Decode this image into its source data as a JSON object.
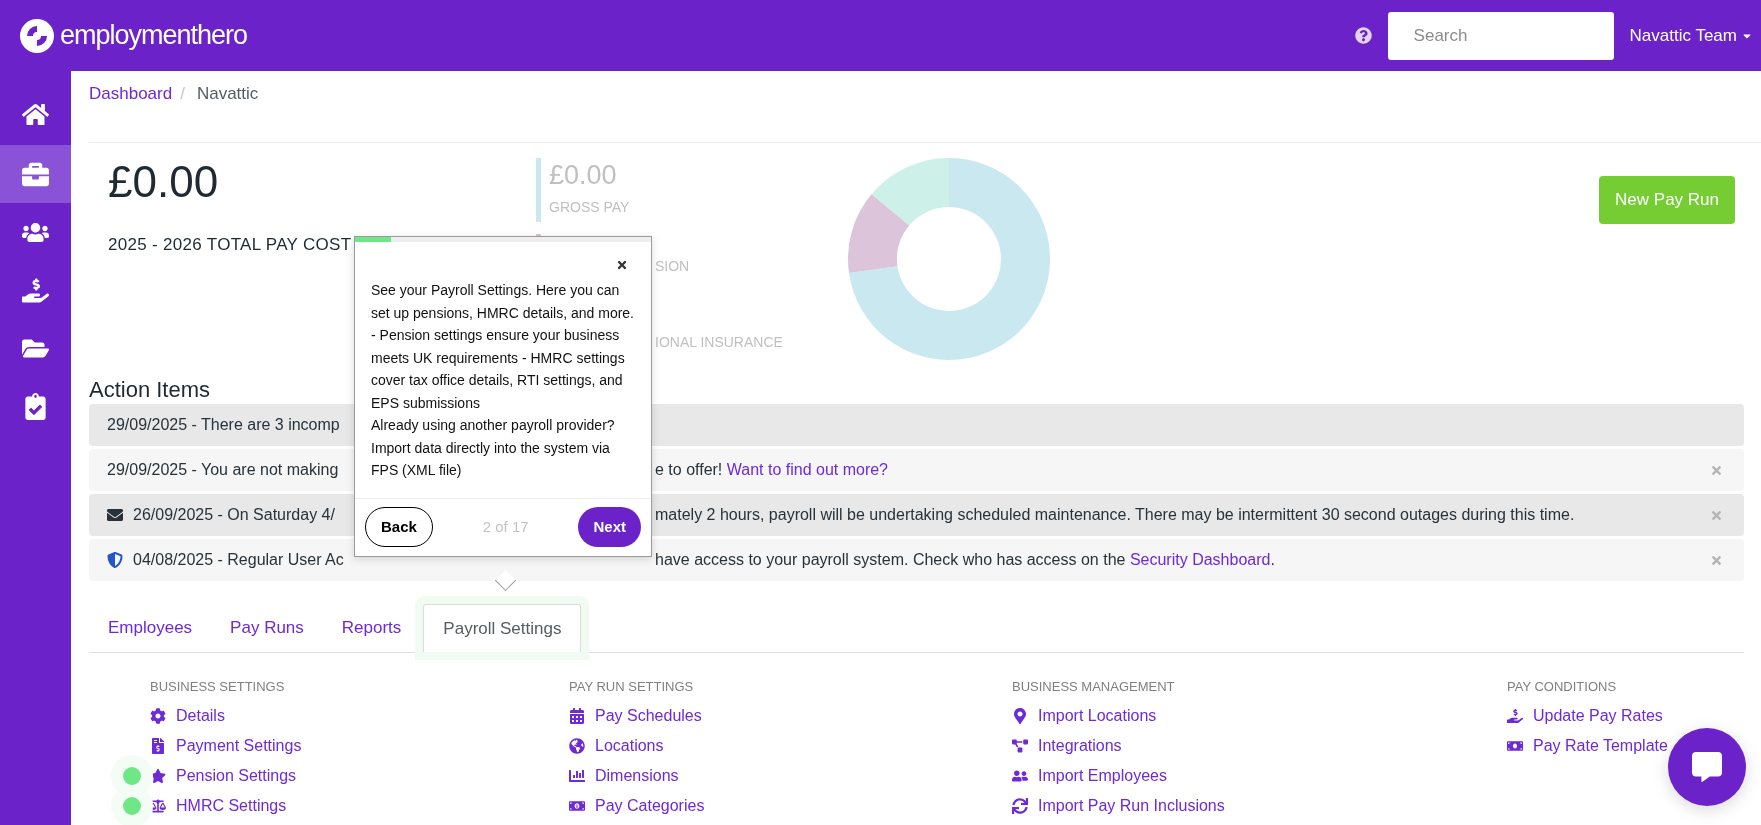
{
  "top_bar": {
    "logo_text": "employmenthero",
    "search": {
      "placeholder": "Search"
    },
    "user_menu": "Navattic Team"
  },
  "sidebar": {
    "items": [
      {
        "selected": false
      },
      {
        "selected": true
      },
      {
        "selected": false
      },
      {
        "selected": false
      },
      {
        "selected": false
      },
      {
        "selected": false
      }
    ]
  },
  "breadcrumb": [
    {
      "label": "Dashboard",
      "kind": "link"
    },
    {
      "label": "Navattic",
      "kind": "current",
      "separator": "/"
    }
  ],
  "summary": {
    "total": "£0.00",
    "total_label": "2025 - 2026 TOTAL PAY COST",
    "stats": [
      {
        "value": "£0.00",
        "label": "GROSS PAY",
        "color": "#c9e8ef"
      },
      {
        "label": "SION",
        "color": "#dcc5da"
      },
      {
        "label": "IONAL INSURANCE"
      }
    ]
  },
  "new_pay_run_button": "New Pay Run",
  "action_items": {
    "title": "Action Items",
    "rows": [
      {
        "kind": "notice",
        "shaded": true,
        "dismissible": false,
        "text_before": "29/09/2025 - There are 3 incomp"
      },
      {
        "kind": "notice",
        "shaded": false,
        "dismissible": true,
        "text_before": "29/09/2025 - You are not making",
        "text_after": "e to offer! ",
        "link": "Want to find out more?"
      },
      {
        "kind": "mail",
        "shaded": true,
        "dismissible": true,
        "text_before": "26/09/2025 - On Saturday 4/",
        "text_after": "mately 2 hours, payroll will be undertaking scheduled maintenance. There may be intermittent 30 second outages during this time."
      },
      {
        "kind": "security",
        "shaded": false,
        "dismissible": true,
        "text_before": "04/08/2025 - Regular User Ac",
        "text_after": "have access to your payroll system. Check who has access on the ",
        "link": "Security Dashboard",
        "text_end": "."
      }
    ]
  },
  "tabs": [
    {
      "label": "Employees",
      "selected": false
    },
    {
      "label": "Pay Runs",
      "selected": false
    },
    {
      "label": "Reports",
      "selected": false
    },
    {
      "label": "Payroll Settings",
      "selected": true
    }
  ],
  "settings_sections": [
    {
      "title": "BUSINESS SETTINGS",
      "items": [
        {
          "label": "Details",
          "hotspot": false
        },
        {
          "label": "Payment Settings",
          "hotspot": false
        },
        {
          "label": "Pension Settings",
          "hotspot": true
        },
        {
          "label": "HMRC Settings",
          "hotspot": true
        }
      ]
    },
    {
      "title": "PAY RUN SETTINGS",
      "items": [
        {
          "label": "Pay Schedules",
          "hotspot": false
        },
        {
          "label": "Locations",
          "hotspot": false
        },
        {
          "label": "Dimensions",
          "hotspot": false
        },
        {
          "label": "Pay Categories",
          "hotspot": false
        }
      ]
    },
    {
      "title": "BUSINESS MANAGEMENT",
      "items": [
        {
          "label": "Import Locations",
          "hotspot": false
        },
        {
          "label": "Integrations",
          "hotspot": false
        },
        {
          "label": "Import Employees",
          "hotspot": false
        },
        {
          "label": "Import Pay Run Inclusions",
          "hotspot": false
        }
      ]
    },
    {
      "title": "PAY CONDITIONS",
      "items": [
        {
          "label": "Update Pay Rates",
          "hotspot": false
        },
        {
          "label": "Pay Rate Template",
          "hotspot": false
        }
      ]
    }
  ],
  "tour_popover": {
    "progress": {
      "level": 0.12
    },
    "paragraphs": [
      "See your Payroll Settings. Here you can set up pensions, HMRC details, and more. - Pension settings ensure your business meets UK requirements - HMRC settings cover tax office details, RTI settings, and EPS submissions",
      "Already using another payroll provider? Import data directly into the system via FPS (XML file)"
    ],
    "back": "Back",
    "step": "2 of 17",
    "next": "Next"
  }
}
